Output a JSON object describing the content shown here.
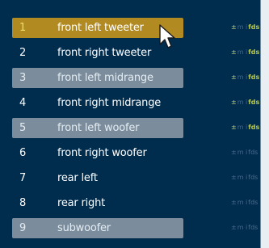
{
  "speakers": [
    {
      "number": "1",
      "label": "front left tweeter",
      "state": "active",
      "meta": {
        "lead": "±",
        "mid": "m i",
        "tail": "fds",
        "dim": false
      }
    },
    {
      "number": "2",
      "label": "front right tweeter",
      "state": "plain",
      "meta": {
        "lead": "±",
        "mid": "m i",
        "tail": "fds",
        "dim": false
      }
    },
    {
      "number": "3",
      "label": "front left midrange",
      "state": "shaded",
      "meta": {
        "lead": "±",
        "mid": "m i",
        "tail": "fds",
        "dim": false
      }
    },
    {
      "number": "4",
      "label": "front right midrange",
      "state": "plain",
      "meta": {
        "lead": "±",
        "mid": "m i",
        "tail": "fds",
        "dim": false
      }
    },
    {
      "number": "5",
      "label": "front left woofer",
      "state": "shaded",
      "meta": {
        "lead": "±",
        "mid": "m i",
        "tail": "fds",
        "dim": false
      }
    },
    {
      "number": "6",
      "label": "front right woofer",
      "state": "plain",
      "meta": {
        "lead": "±",
        "mid": "m i",
        "tail": "fds",
        "dim": true
      }
    },
    {
      "number": "7",
      "label": "rear left",
      "state": "plain",
      "meta": {
        "lead": "±",
        "mid": "m i",
        "tail": "fds",
        "dim": true
      }
    },
    {
      "number": "8",
      "label": "rear right",
      "state": "plain",
      "meta": {
        "lead": "±",
        "mid": "m i",
        "tail": "fds",
        "dim": true
      }
    },
    {
      "number": "9",
      "label": "subwoofer",
      "state": "shaded",
      "meta": {
        "lead": "±",
        "mid": "m i",
        "tail": "fds",
        "dim": true
      }
    }
  ],
  "colors": {
    "background": "#002c4e",
    "active_bar": "#b18a21",
    "shaded_bar": "#7b8c9c",
    "meta_highlight": "#c8d35a"
  },
  "cursor": {
    "icon": "mouse-pointer-icon"
  }
}
